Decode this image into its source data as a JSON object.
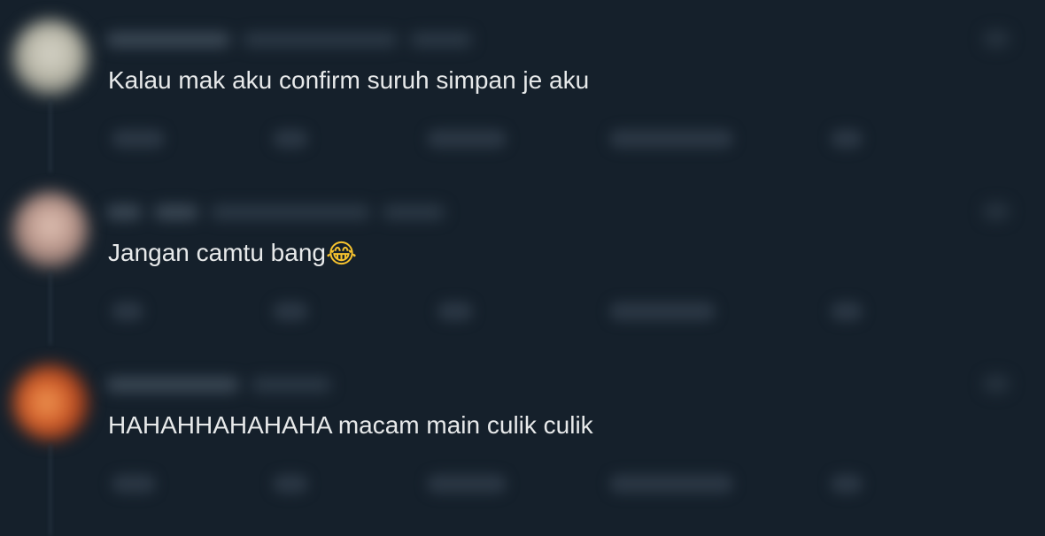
{
  "replies": [
    {
      "text": "Kalau mak aku confirm suruh simpan je aku",
      "emoji": ""
    },
    {
      "text": "Jangan camtu bang",
      "emoji": "😂"
    },
    {
      "text": "HAHAHHAHAHAHA macam main culik culik",
      "emoji": ""
    }
  ],
  "icons": {
    "avatar": "user-avatar",
    "reply": "reply-icon",
    "repost": "repost-icon",
    "like": "heart-icon",
    "views": "analytics-icon",
    "share": "share-icon",
    "more": "more-options-icon"
  },
  "colors": {
    "background": "#15202b",
    "text": "#e7e9ea",
    "blurred_ui": "#3e4b58"
  }
}
